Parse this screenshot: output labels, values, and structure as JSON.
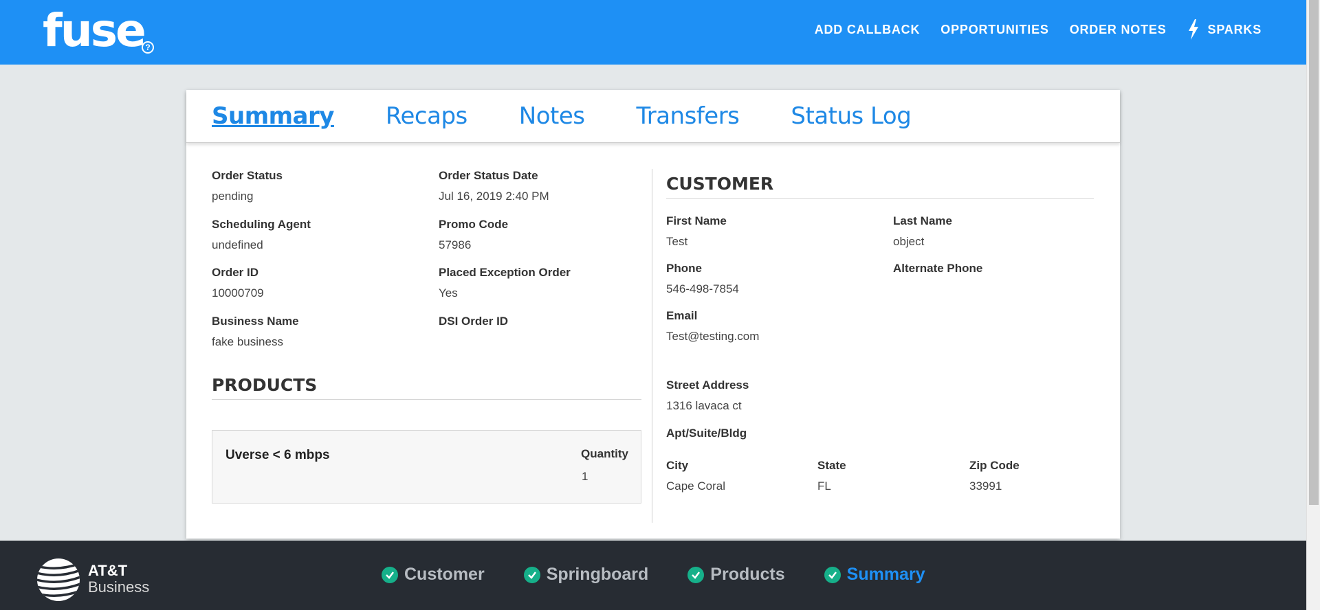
{
  "header": {
    "logo": "fuse",
    "help_icon": "?",
    "nav": [
      {
        "label": "ADD CALLBACK"
      },
      {
        "label": "OPPORTUNITIES"
      },
      {
        "label": "ORDER NOTES"
      },
      {
        "label": "SPARKS",
        "icon": "bolt-icon"
      }
    ],
    "bg_color": "#1e90f5"
  },
  "tabs": [
    {
      "label": "Summary",
      "active": true
    },
    {
      "label": "Recaps"
    },
    {
      "label": "Notes"
    },
    {
      "label": "Transfers"
    },
    {
      "label": "Status Log"
    }
  ],
  "order": {
    "status_label": "Order Status",
    "status": "pending",
    "status_date_label": "Order Status Date",
    "status_date": "Jul 16, 2019 2:40 PM",
    "agent_label": "Scheduling Agent",
    "agent": "undefined",
    "promo_label": "Promo Code",
    "promo": "57986",
    "id_label": "Order ID",
    "id": "10000709",
    "exception_label": "Placed Exception Order",
    "exception": "Yes",
    "business_label": "Business Name",
    "business": "fake business",
    "dsi_label": "DSI Order ID",
    "dsi": ""
  },
  "products": {
    "title": "PRODUCTS",
    "items": [
      {
        "name": "Uverse < 6 mbps",
        "qty_label": "Quantity",
        "qty": "1"
      }
    ]
  },
  "customer": {
    "title": "CUSTOMER",
    "first_name_label": "First Name",
    "first_name": "Test",
    "last_name_label": "Last Name",
    "last_name": "object",
    "phone_label": "Phone",
    "phone": "546-498-7854",
    "alt_phone_label": "Alternate Phone",
    "alt_phone": "",
    "email_label": "Email",
    "email": "Test@testing.com",
    "street_label": "Street Address",
    "street": "1316 lavaca ct",
    "apt_label": "Apt/Suite/Bldg",
    "apt": "",
    "city_label": "City",
    "city": "Cape Coral",
    "state_label": "State",
    "state": "FL",
    "zip_label": "Zip Code",
    "zip": "33991"
  },
  "footer": {
    "brand_line1": "AT&T",
    "brand_line2": "Business",
    "steps": [
      {
        "label": "Customer",
        "complete": true
      },
      {
        "label": "Springboard",
        "complete": true
      },
      {
        "label": "Products",
        "complete": true
      },
      {
        "label": "Summary",
        "complete": true,
        "current": true
      }
    ],
    "check_color": "#16b08a",
    "current_color": "#1e90f5"
  }
}
